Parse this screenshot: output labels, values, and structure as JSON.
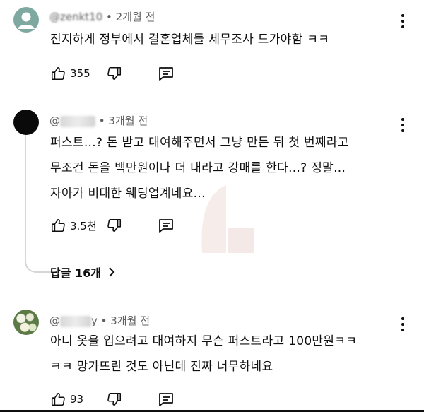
{
  "comments": [
    {
      "username": "@zenkt10",
      "time": "2개월 전",
      "lines": [
        "진지하게 정부에서 결혼업체들 세무조사 드가야함 ㅋㅋ"
      ],
      "likes": "355"
    },
    {
      "username": "@",
      "time": "3개월 전",
      "lines": [
        "퍼스트...? 돈 받고 대여해주면서 그냥 만든 뒤 첫 번째라고",
        "무조건 돈을 백만원이나 더 내라고 강매를 한다...? 정말...",
        "자아가 비대한 웨딩업계네요..."
      ],
      "likes": "3.5천",
      "replies_label": "답글 16개"
    },
    {
      "username": "@",
      "username_suffix": "y",
      "time": "3개월 전",
      "lines": [
        "아니 옷을 입으려고 대여하지 무슨 퍼스트라고 100만원ㅋㅋ",
        "ㅋㅋ 망가뜨린 것도 아닌데 진짜 너무하네요"
      ],
      "likes": "93"
    }
  ],
  "icons": {
    "like": "thumbs-up-icon",
    "dislike": "thumbs-down-icon",
    "reply": "reply-comment-icon",
    "menu": "more-vert-icon",
    "expand": "chevron-right-icon"
  },
  "colors": {
    "text": "#0f0f0f",
    "meta": "#606060",
    "thread": "#d6d6d6"
  }
}
